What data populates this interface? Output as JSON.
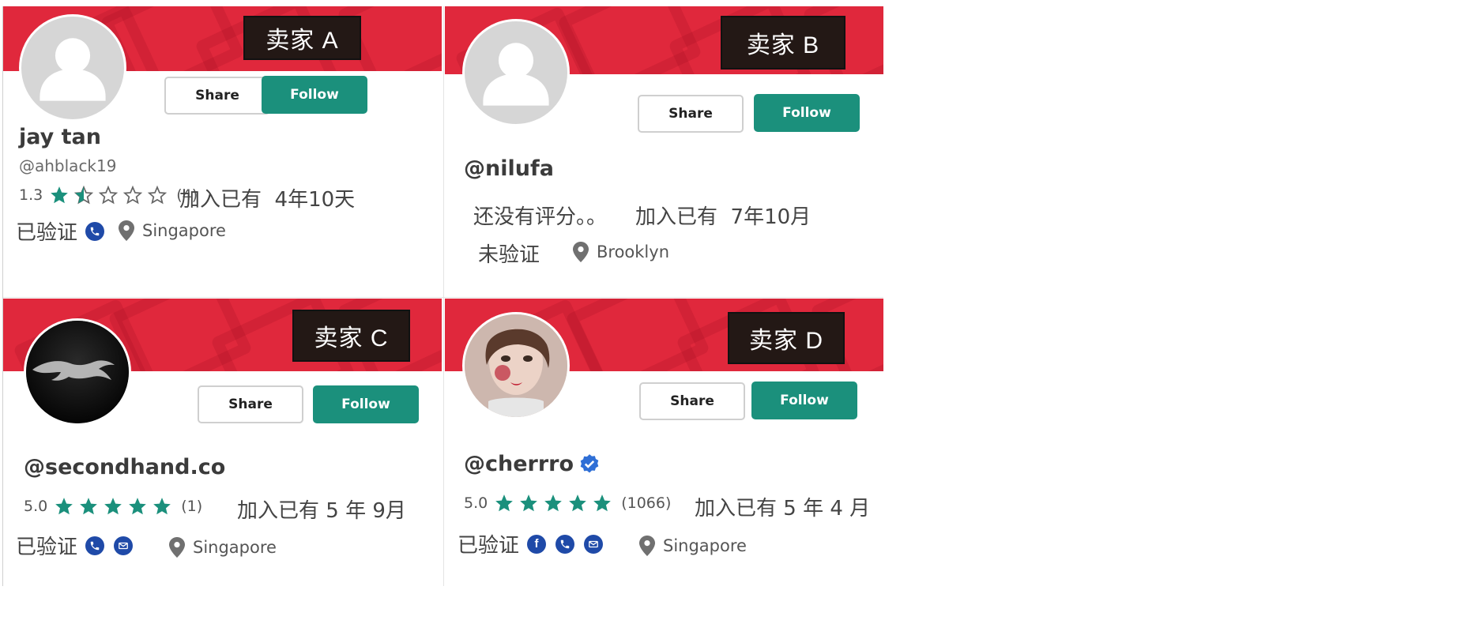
{
  "common": {
    "share_label": "Share",
    "follow_label": "Follow",
    "joined_prefix": "加入已有",
    "verified_label": "已验证",
    "unverified_label": "未验证"
  },
  "colors": {
    "banner": "#e0283c",
    "follow": "#1b907c",
    "star": "#1b907c",
    "verify_icon": "#1f4aa8",
    "tag_bg": "#231815"
  },
  "cards": {
    "a": {
      "tag": "卖家 A",
      "name": "jay tan",
      "handle": "@ahblack19",
      "rating": "1.3",
      "rating_stars": 1.3,
      "review_count": "(4)",
      "joined": "4年10天",
      "verify_icons": [
        "phone-icon"
      ],
      "location": "Singapore"
    },
    "b": {
      "tag": "卖家  B",
      "handle": "@nilufa",
      "no_rating": "还没有评分。。",
      "joined": "7年10月",
      "location": "Brooklyn"
    },
    "c": {
      "tag": "卖家 C",
      "handle": "@secondhand.co",
      "rating": "5.0",
      "rating_stars": 5,
      "review_count": "(1)",
      "joined": "5 年 9月",
      "verify_icons": [
        "phone-icon",
        "email-icon"
      ],
      "location": "Singapore"
    },
    "d": {
      "tag": "卖家 D",
      "handle": "@cherrro",
      "rating": "5.0",
      "rating_stars": 5,
      "review_count": "(1066)",
      "joined": "5 年 4 月",
      "verify_icons": [
        "facebook-icon",
        "phone-icon",
        "email-icon"
      ],
      "location": "Singapore"
    }
  }
}
